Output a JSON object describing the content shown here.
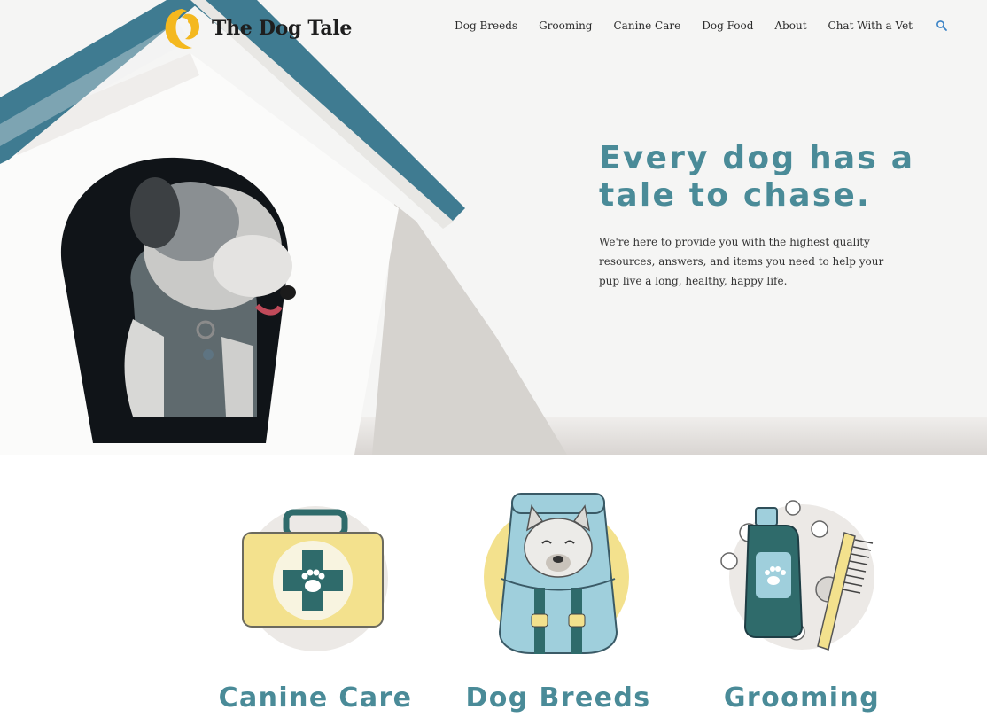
{
  "brand": {
    "name": "The Dog Tale"
  },
  "nav": {
    "items": [
      {
        "label": "Dog Breeds"
      },
      {
        "label": "Grooming"
      },
      {
        "label": "Canine Care"
      },
      {
        "label": "Dog Food"
      },
      {
        "label": "About"
      },
      {
        "label": "Chat With a Vet"
      }
    ],
    "search_icon": "search-icon"
  },
  "hero": {
    "title": "Every dog has a tale to chase.",
    "body": "We're here to provide you with the highest quality resources, answers, and items you need to help your pup live a long, healthy, happy life."
  },
  "categories": [
    {
      "title": "Canine Care",
      "icon": "first-aid-kit-icon"
    },
    {
      "title": "Dog Breeds",
      "icon": "dog-backpack-icon"
    },
    {
      "title": "Grooming",
      "icon": "shampoo-brush-icon"
    }
  ],
  "colors": {
    "accent": "#4a8b98",
    "roof": "#3f7b91",
    "yellow": "#f3e18d",
    "teal_dark": "#2f6b6b",
    "light_blue": "#9fcfdc",
    "circle_gray": "#ece9e6"
  }
}
